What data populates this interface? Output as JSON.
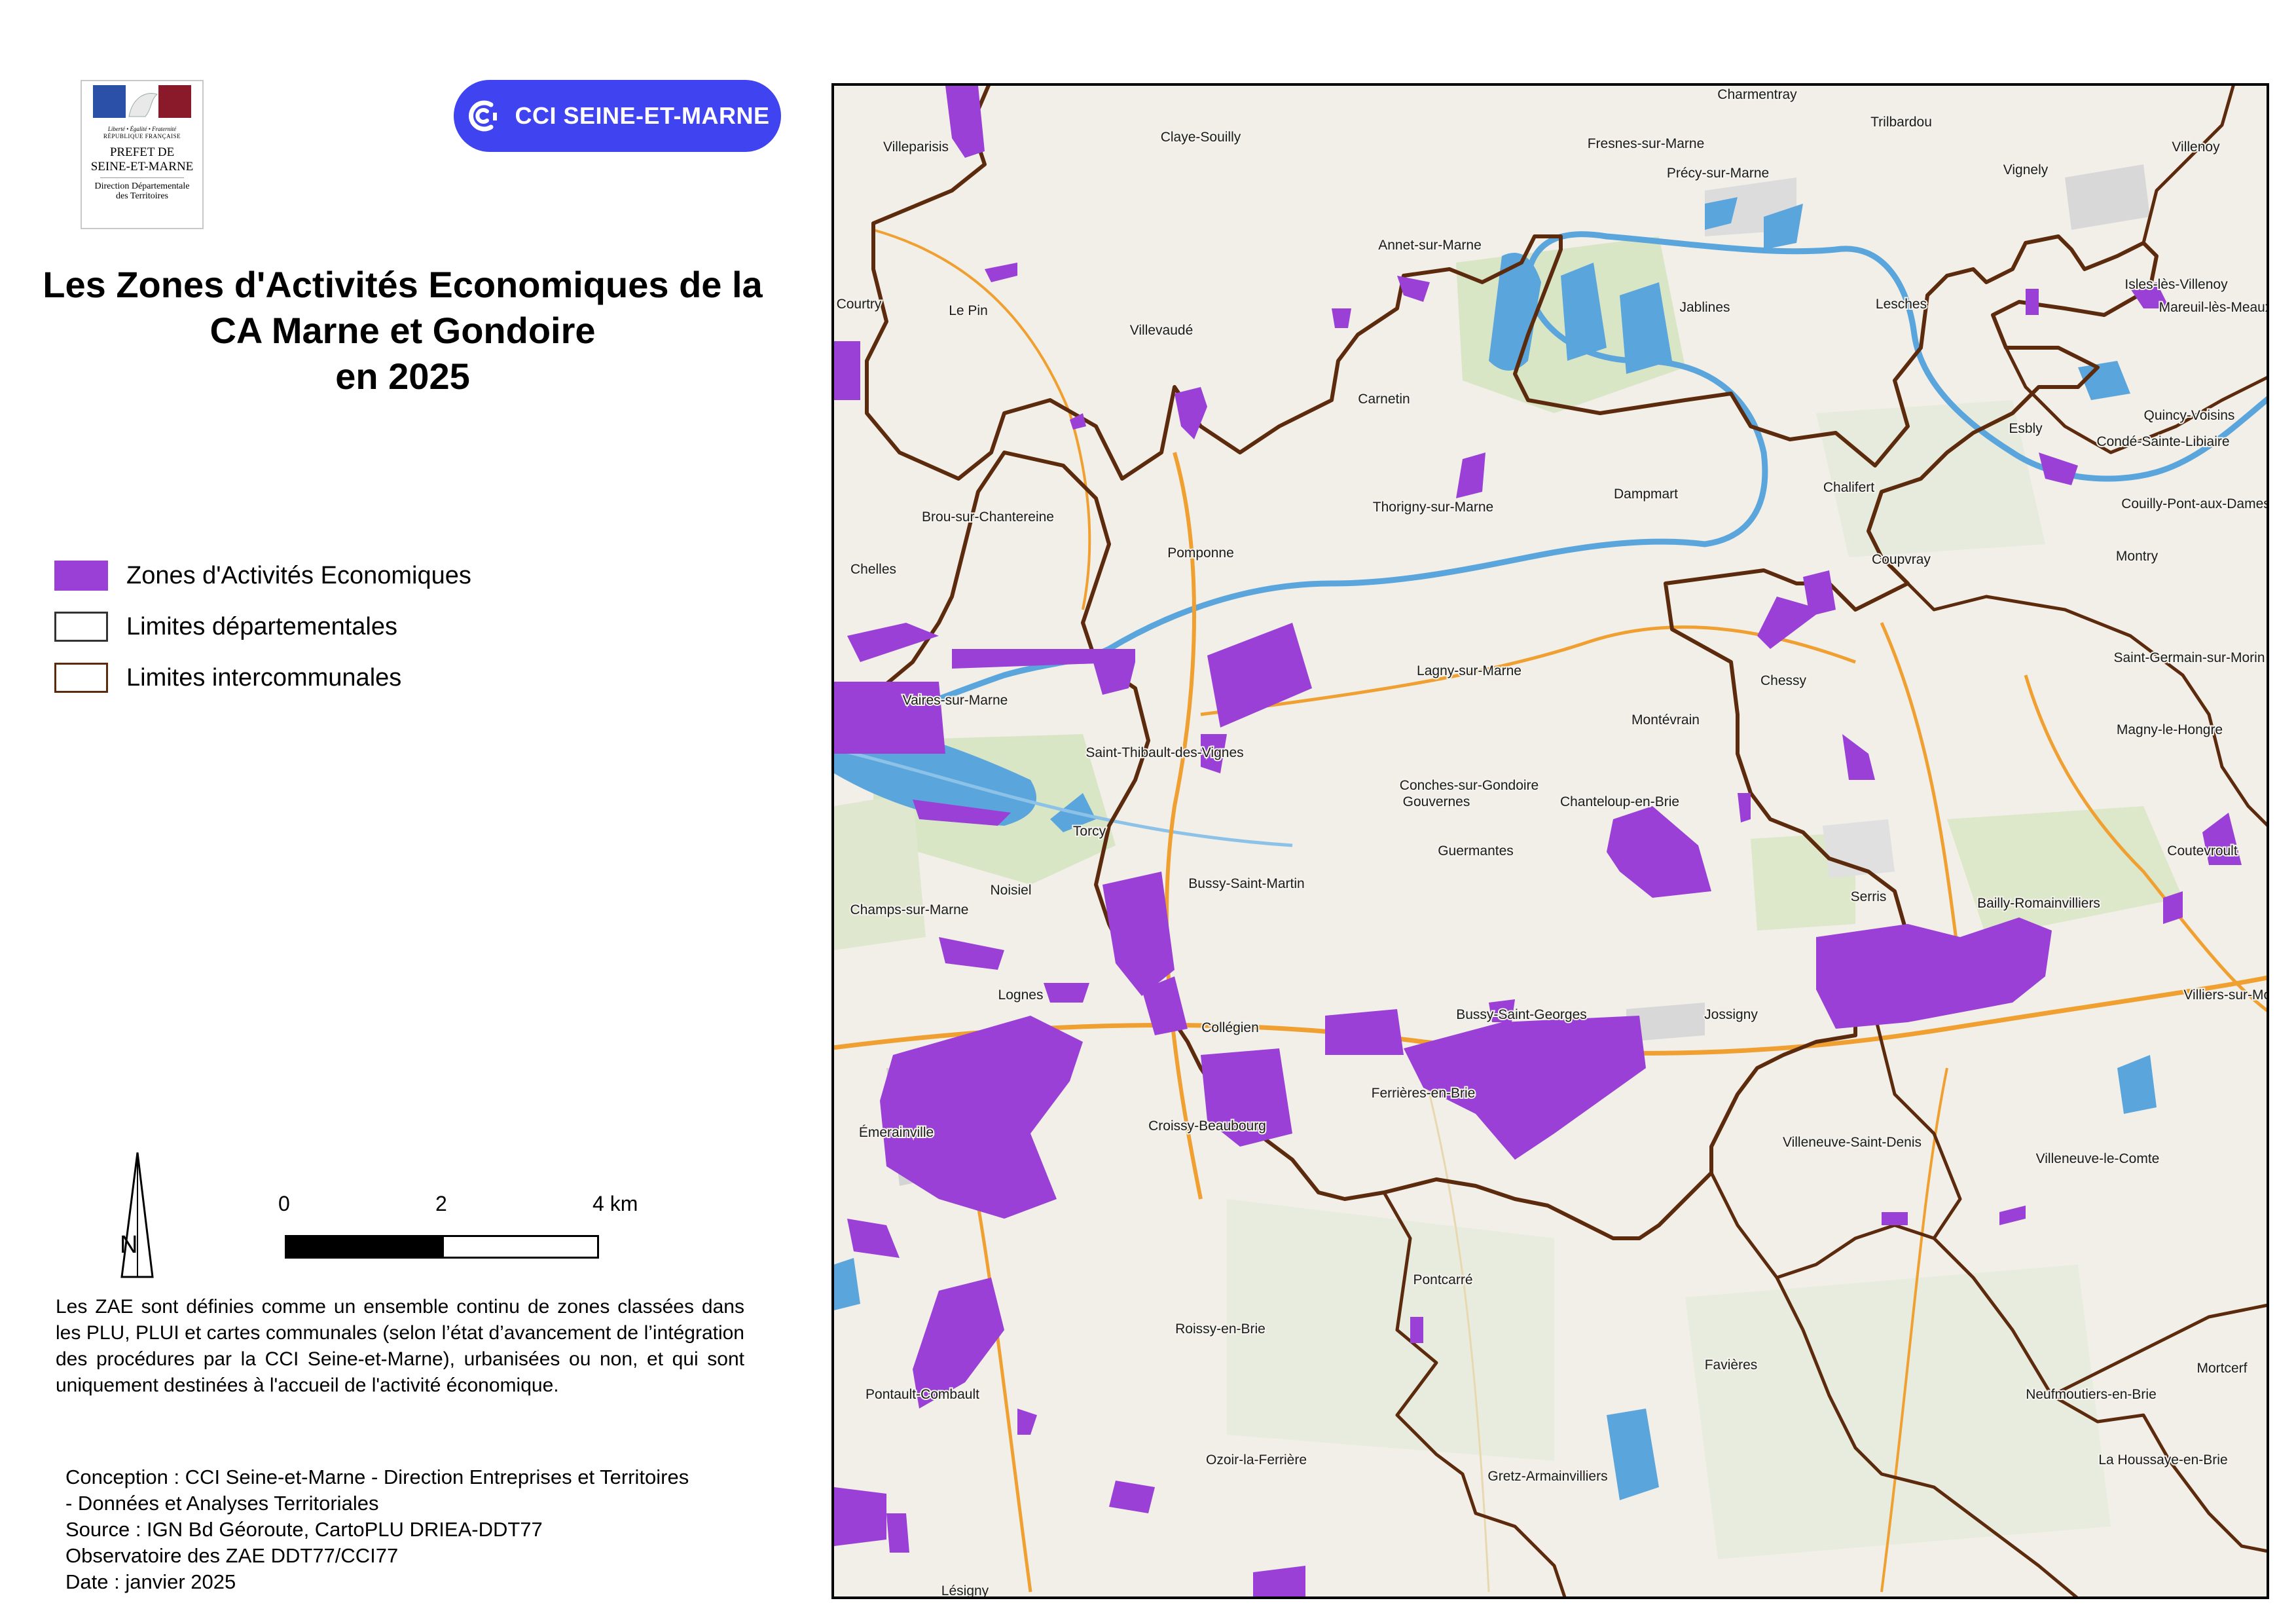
{
  "logos": {
    "prefet": {
      "motto": "Liberté • Égalité • Fraternité",
      "republic": "RÉPUBLIQUE FRANÇAISE",
      "line1": "PREFET DE",
      "line2": "SEINE-ET-MARNE",
      "line3": "Direction Départementale",
      "line4": "des Territoires"
    },
    "cci": {
      "text": "CCI SEINE-ET-MARNE",
      "color": "#3f43f0"
    }
  },
  "title": {
    "line1": "Les Zones d'Activités Economiques de la",
    "line2": "CA Marne et Gondoire",
    "line3": "en 2025"
  },
  "legend": [
    {
      "label": "Zones d'Activités Economiques",
      "fill": "#9a40d6",
      "border": "#9a40d6"
    },
    {
      "label": "Limites départementales",
      "fill": "#ffffff",
      "border": "#333333"
    },
    {
      "label": "Limites intercommunales",
      "fill": "#ffffff",
      "border": "#5c2a0d"
    }
  ],
  "north": {
    "label": "N"
  },
  "scale": {
    "labels": [
      "0",
      "2",
      "4 km"
    ]
  },
  "description": "Les ZAE sont définies comme un ensemble continu de zones classées dans les PLU, PLUI et cartes communales (selon l’état d’avancement de l’intégration des procédures par la CCI Seine-et-Marne), urbanisées ou non, et qui sont uniquement destinées à l'accueil de l'activité économique.",
  "credits": [
    "Conception : CCI Seine-et-Marne - Direction Entreprises et Territoires",
    "- Données et Analyses Territoriales",
    "Source : IGN Bd Géoroute, CartoPLU DRIEA-DDT77",
    "Observatoire des ZAE DDT77/CCI77",
    "Date : janvier 2025"
  ],
  "colors": {
    "zae": "#9a40d6",
    "boundary": "#5c2a0d",
    "water": "#5aa5dc",
    "road": "#f0a030",
    "base": "#f1efe8",
    "green": "#d9e6c6"
  },
  "places": [
    "Charmentray",
    "Villeparisis",
    "Claye-Souilly",
    "Fresnes-sur-Marne",
    "Trilbardou",
    "Vignely",
    "Villenoy",
    "Précy-sur-Marne",
    "Annet-sur-Marne",
    "Courtry",
    "Le Pin",
    "Villevaudé",
    "Jablines",
    "Lesches",
    "Isles-lès-Villenoy",
    "Mareuil-lès-Meaux",
    "Carnetin",
    "Quincy-Voisins",
    "Esbly",
    "Condé-Sainte-Libiaire",
    "Chalifert",
    "Dampmart",
    "Thorigny-sur-Marne",
    "Brou-sur-Chantereine",
    "Couilly-Pont-aux-Dames",
    "Pomponne",
    "Chelles",
    "Coupvray",
    "Montry",
    "Lagny-sur-Marne",
    "Saint-Germain-sur-Morin",
    "Chessy",
    "Vaires-sur-Marne",
    "Montévrain",
    "Magny-le-Hongre",
    "Saint-Thibault-des-Vignes",
    "Conches-sur-Gondoire",
    "Gouvernes",
    "Chanteloup-en-Brie",
    "Torcy",
    "Guermantes",
    "Coutevroult",
    "Noisiel",
    "Bussy-Saint-Martin",
    "Serris",
    "Bailly-Romainvilliers",
    "Champs-sur-Marne",
    "Villiers-sur-Morin",
    "Lognes",
    "Bussy-Saint-Georges",
    "Jossigny",
    "Collégien",
    "Ferrières-en-Brie",
    "Émerainville",
    "Croissy-Beaubourg",
    "Villeneuve-Saint-Denis",
    "Villeneuve-le-Comte",
    "Pontcarré",
    "Roissy-en-Brie",
    "Favières",
    "Mortcerf",
    "Pontault-Combault",
    "Neufmoutiers-en-Brie",
    "Ozoir-la-Ferrière",
    "La Houssaye-en-Brie",
    "Gretz-Armainvilliers",
    "Lésigny"
  ]
}
